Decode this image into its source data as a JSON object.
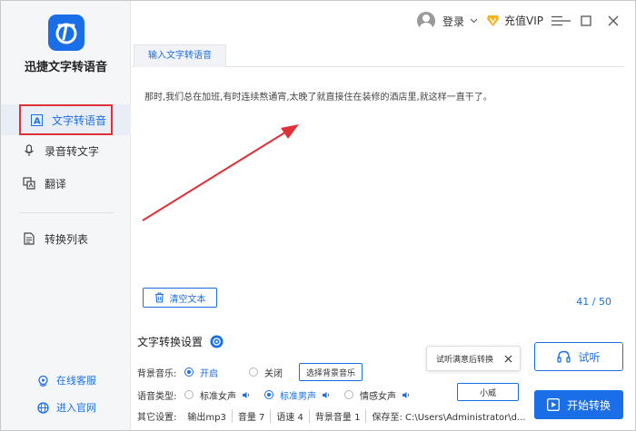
{
  "app": {
    "name": "迅捷文字转语音"
  },
  "nav": {
    "items": [
      {
        "label": "文字转语音",
        "icon": "text-to-speech-icon",
        "active": true
      },
      {
        "label": "录音转文字",
        "icon": "microphone-icon",
        "active": false
      },
      {
        "label": "翻译",
        "icon": "translate-icon",
        "active": false
      }
    ],
    "conversion_list": "转换列表",
    "online_service": "在线客服",
    "official_site": "进入官网"
  },
  "header": {
    "login": "登录",
    "vip": "充值VIP"
  },
  "tabs": [
    {
      "label": "输入文字转语音"
    }
  ],
  "editor": {
    "text": "那时,我们总在加班,有时连续熬通宵,太晚了就直接住在装修的酒店里,就这样一直干了。",
    "clear_label": "清空文本",
    "counter": "41 / 50"
  },
  "settings": {
    "title": "文字转换设置",
    "bgm": {
      "label": "背景音乐:",
      "options": [
        "开启",
        "关闭"
      ],
      "selected": "开启",
      "choose_button": "选择背景音乐"
    },
    "voice": {
      "label": "语音类型:",
      "options": [
        "标准女声",
        "标准男声",
        "情感女声"
      ],
      "selected": "标准男声",
      "extra_button": "小威"
    },
    "other": {
      "label": "其它设置:",
      "items": [
        "输出mp3",
        "音量 7",
        "语速 4",
        "背景音量 1",
        "保存至: C:\\Users\\Administrator\\d..."
      ]
    }
  },
  "tooltip": {
    "text": "试听满意后转换"
  },
  "actions": {
    "listen": "试听",
    "start": "开始转换"
  },
  "colors": {
    "accent": "#1a6fe8",
    "highlight_box": "#e0303a",
    "arrow": "#e0303a"
  }
}
